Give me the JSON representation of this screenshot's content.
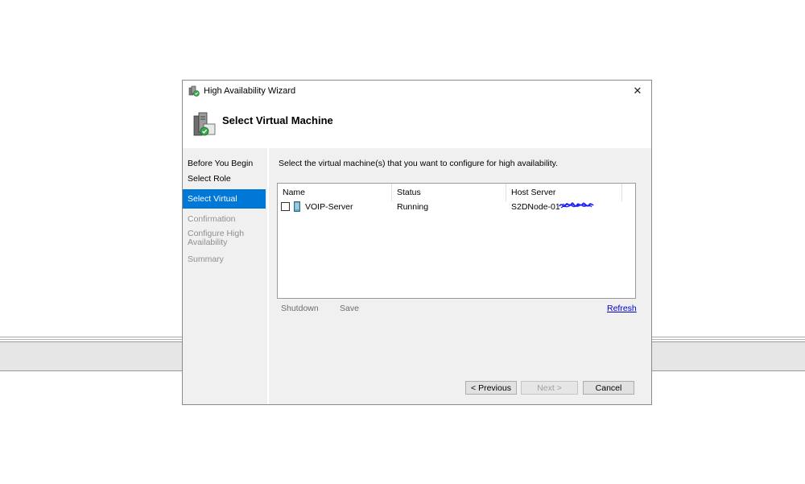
{
  "window": {
    "title": "High Availability Wizard",
    "close_glyph": "✕"
  },
  "header": {
    "title": "Select Virtual Machine",
    "icon": "cluster-wizard-icon"
  },
  "nav": {
    "items": [
      {
        "label": "Before You Begin",
        "state": "normal"
      },
      {
        "label": "Select Role",
        "state": "normal"
      },
      {
        "label": "Select Virtual Machine",
        "state": "active"
      },
      {
        "label": "Confirmation",
        "state": "disabled"
      },
      {
        "label": "Configure High Availability",
        "state": "disabled"
      },
      {
        "label": "Summary",
        "state": "disabled"
      }
    ]
  },
  "main": {
    "instruction": "Select the virtual machine(s) that you want to configure for high availability.",
    "columns": [
      "Name",
      "Status",
      "Host Server"
    ],
    "rows": [
      {
        "checked": false,
        "name": "VOIP-Server",
        "status": "Running",
        "host": "S2DNode-01"
      }
    ],
    "actions": {
      "shutdown": "Shutdown",
      "save": "Save",
      "refresh": "Refresh"
    }
  },
  "buttons": {
    "previous": "< Previous",
    "next": "Next >",
    "cancel": "Cancel"
  },
  "colors": {
    "accent": "#0078d7",
    "link": "#0000cc",
    "redaction": "#1a1aff"
  }
}
